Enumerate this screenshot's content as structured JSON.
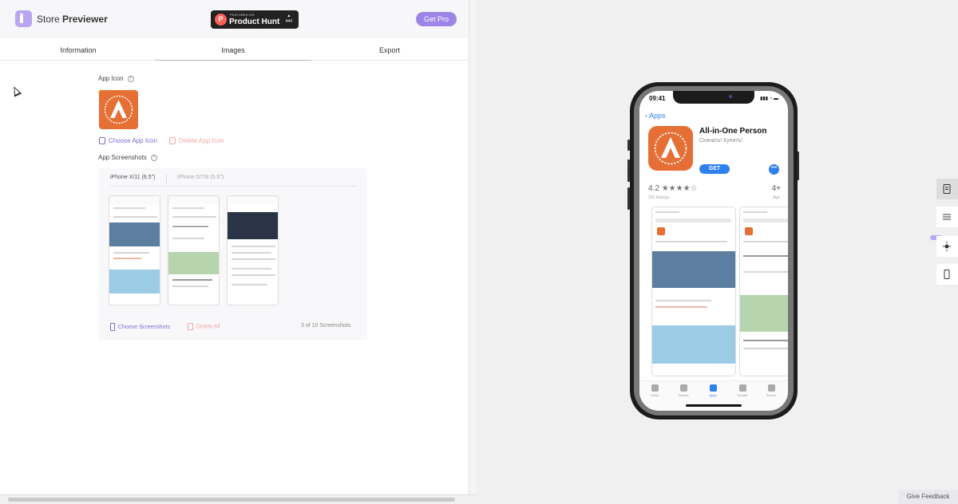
{
  "header": {
    "brand_first": "Store",
    "brand_second": "Previewer",
    "product_hunt": {
      "small": "FEATURED ON",
      "name": "Product Hunt",
      "votes": "444"
    },
    "get_pro_label": "Get Pro"
  },
  "tabs": [
    {
      "label": "Information"
    },
    {
      "label": "Images",
      "active": true
    },
    {
      "label": "Export"
    }
  ],
  "app_icon": {
    "section_label": "App Icon",
    "choose_label": "Choose App Icon",
    "delete_label": "Delete App Icon"
  },
  "app_screenshots": {
    "section_label": "App Screenshots",
    "device_tabs": [
      {
        "label": "iPhone X/11 (6.5\")",
        "active": true
      },
      {
        "label": "iPhone 6/7/8 (5.5\")"
      }
    ],
    "choose_label": "Choose Screenshots",
    "delete_label": "Delete All",
    "count_text": "3 of 10 Screenshots"
  },
  "preview": {
    "time": "09:41",
    "back_label": "Apps",
    "app_name": "All-in-One Person",
    "app_subtitle": "Скачать! Купить!",
    "get_label": "GET",
    "more_label": "•••",
    "rating": "4.2",
    "stars": "★★★★☆",
    "ratings_count": "250 Ratings",
    "age": "4+",
    "age_label": "Age",
    "tab_bar": [
      {
        "label": "Today"
      },
      {
        "label": "Games"
      },
      {
        "label": "Apps",
        "active": true
      },
      {
        "label": "Arcade"
      },
      {
        "label": "Search"
      }
    ]
  },
  "colors": {
    "accent": "#9d85e8",
    "app_orange": "#e66f35",
    "ios_blue": "#2f80ed",
    "delete_red": "#f3a6a6"
  },
  "toolbar_icons": [
    "document-icon",
    "list-icon",
    "sun-icon",
    "phone-icon"
  ],
  "feedback_label": "Give Feedback"
}
